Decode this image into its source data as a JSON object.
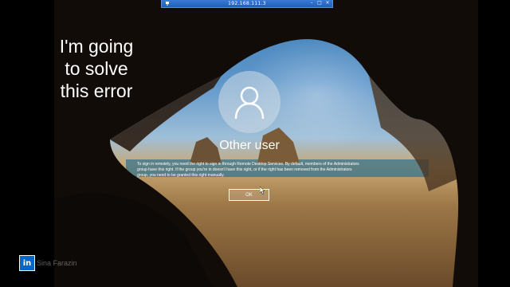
{
  "rdp_bar": {
    "title": "192.168.111.3"
  },
  "overlay": {
    "line1": "I'm going",
    "line2": "to solve",
    "line3": "this error"
  },
  "login": {
    "user_name": "Other user",
    "message": "To sign in remotely, you need the right to sign in through Remote Desktop Services. By default, members of the Administrators group have this right. If the group you're in doesn't have this right, or if the right has been removed from the Administrators group, you need to be granted this right manually.",
    "ok_label": "OK"
  },
  "watermark": {
    "logo": "in",
    "author": "Sina Farazin"
  },
  "icons": {
    "avatar": "user-icon",
    "pin": "pin-icon",
    "cursor": "mouse-pointer-icon"
  }
}
